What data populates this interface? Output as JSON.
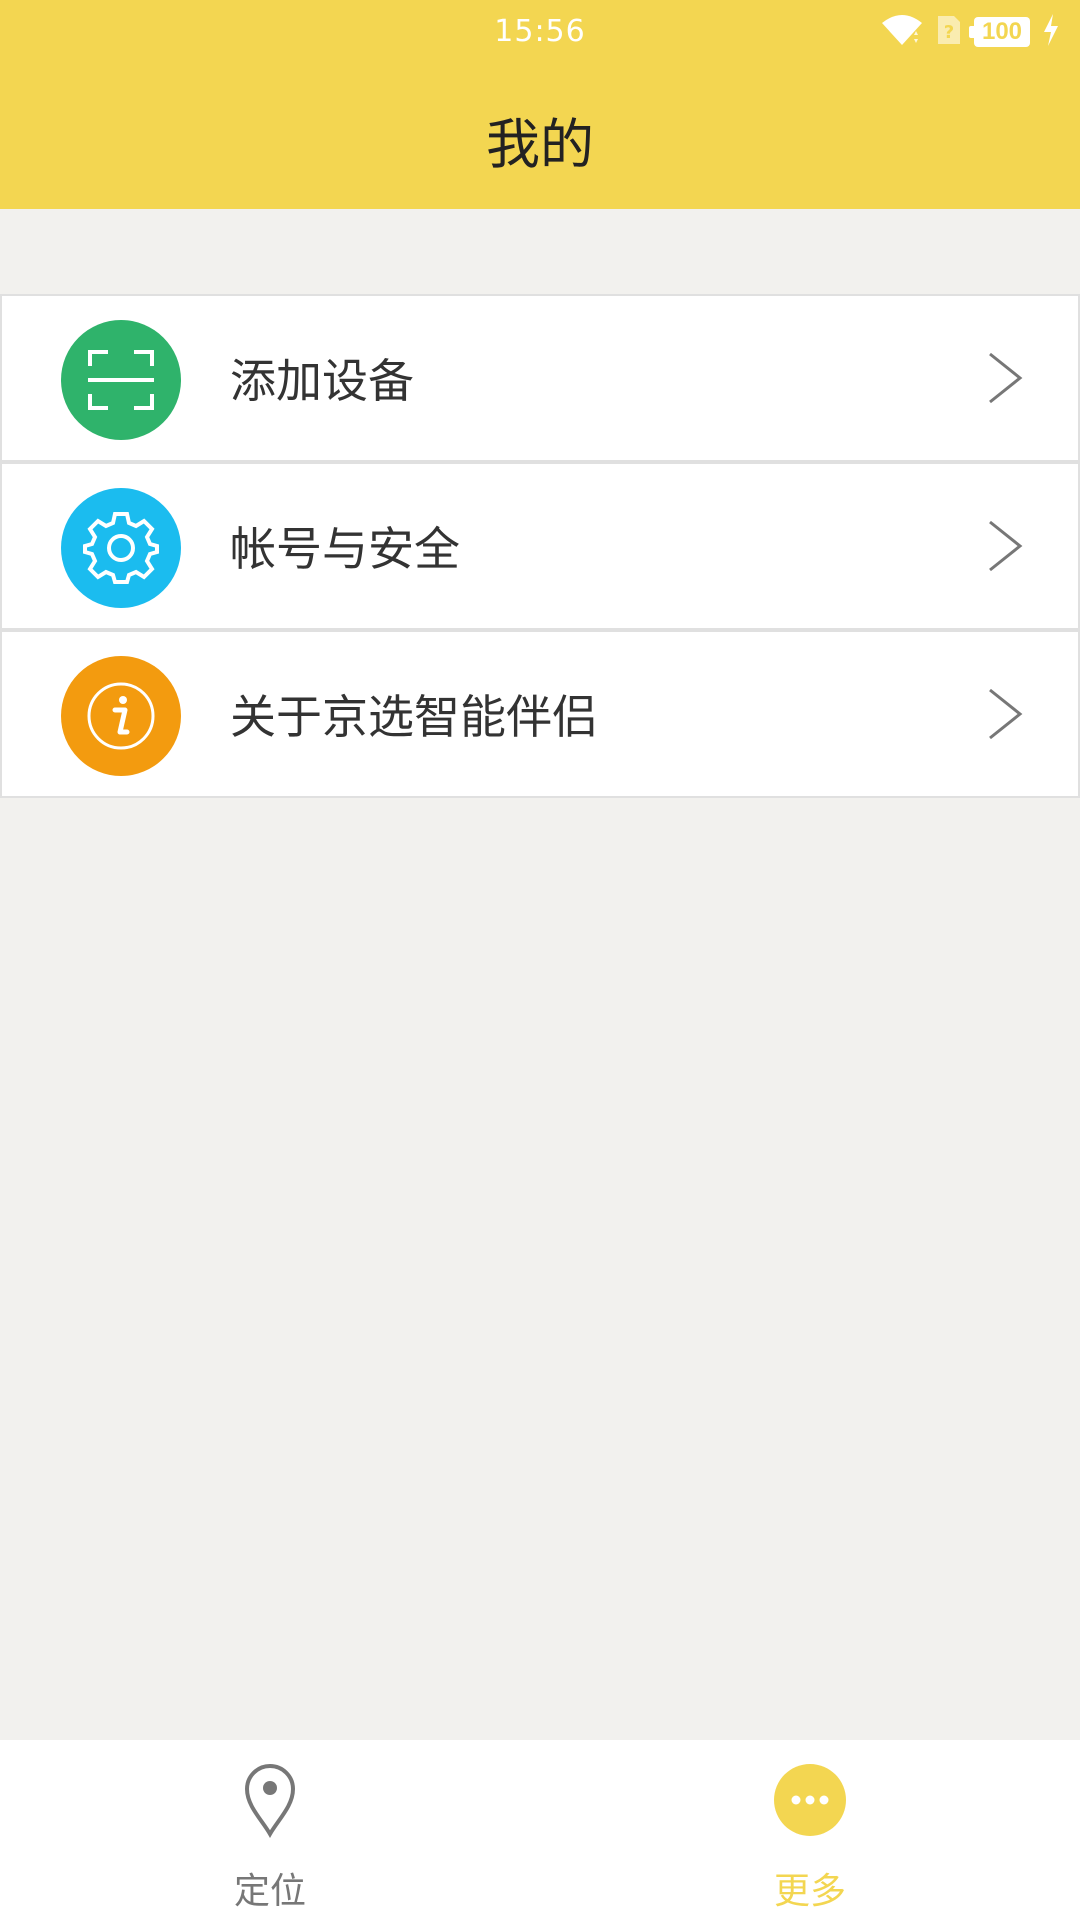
{
  "status_bar": {
    "time": "15:56",
    "battery_level": "100",
    "icons": [
      "wifi-icon",
      "no-sim-icon",
      "battery-icon",
      "charging-icon"
    ]
  },
  "header": {
    "title": "我的",
    "background_color": "#f3d651"
  },
  "menu": {
    "items": [
      {
        "label": "添加设备",
        "icon": "scan-icon",
        "color": "#2fb36b"
      },
      {
        "label": "帐号与安全",
        "icon": "gear-icon",
        "color": "#1bbcef"
      },
      {
        "label": "关于京选智能伴侣",
        "icon": "info-icon",
        "color": "#f39b0f"
      }
    ]
  },
  "tabbar": {
    "tabs": [
      {
        "label": "定位",
        "icon": "location-pin-icon",
        "active": false,
        "color": "#777777"
      },
      {
        "label": "更多",
        "icon": "more-icon",
        "active": true,
        "color": "#f3d651"
      }
    ]
  }
}
